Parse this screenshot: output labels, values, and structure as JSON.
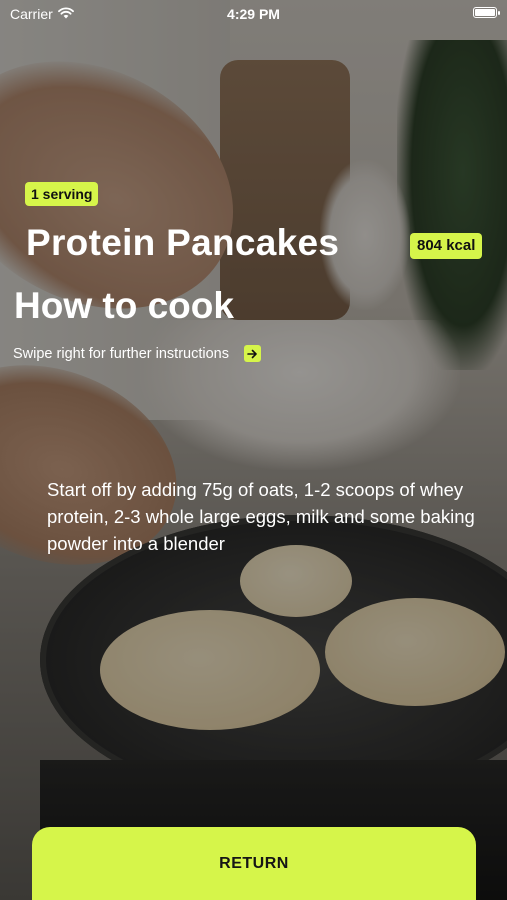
{
  "status_bar": {
    "carrier": "Carrier",
    "time": "4:29 PM"
  },
  "recipe": {
    "serving_badge": "1 serving",
    "title": "Protein Pancakes",
    "kcal_badge": "804 kcal"
  },
  "instructions": {
    "heading": "How to cook",
    "swipe_hint": "Swipe right for further instructions",
    "step_text": "Start off by adding 75g of oats, 1-2 scoops of whey protein, 2-3 whole large eggs, milk and some baking powder into a blender"
  },
  "actions": {
    "return_label": "RETURN"
  },
  "icons": {
    "wifi": "wifi-icon",
    "battery": "battery-icon",
    "arrow": "arrow-right-icon"
  },
  "colors": {
    "accent": "#d6f54a",
    "text": "#ffffff"
  }
}
